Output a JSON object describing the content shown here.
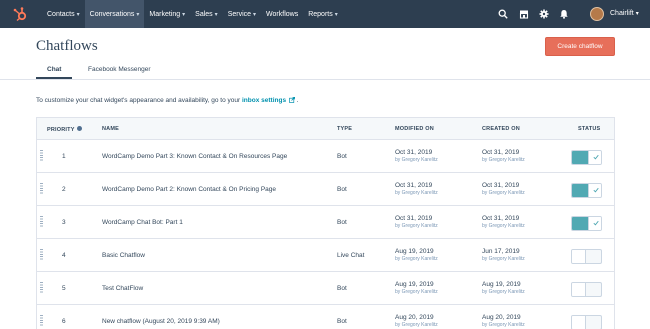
{
  "nav": {
    "items": [
      {
        "label": "Contacts",
        "active": false
      },
      {
        "label": "Conversations",
        "active": true
      },
      {
        "label": "Marketing",
        "active": false
      },
      {
        "label": "Sales",
        "active": false
      },
      {
        "label": "Service",
        "active": false
      },
      {
        "label": "Workflows",
        "active": false,
        "no_caret": true
      },
      {
        "label": "Reports",
        "active": false
      }
    ],
    "icons": [
      "search-icon",
      "marketplace-icon",
      "settings-icon",
      "notifications-icon"
    ],
    "account_name": "Chairlift"
  },
  "page": {
    "title": "Chatflows",
    "create_button": "Create chatflow"
  },
  "tabs": [
    {
      "label": "Chat",
      "active": true
    },
    {
      "label": "Facebook Messenger",
      "active": false
    }
  ],
  "info": {
    "prefix": "To customize your chat widget's appearance and availability, go to your",
    "link": "inbox settings",
    "suffix": "."
  },
  "table": {
    "headers": {
      "priority": "PRIORITY",
      "name": "NAME",
      "type": "TYPE",
      "modified": "MODIFIED ON",
      "created": "CREATED ON",
      "status": "STATUS"
    },
    "rows": [
      {
        "priority": "1",
        "name": "WordCamp Demo Part 3: Known Contact & On Resources Page",
        "type": "Bot",
        "modified": "Oct 31, 2019",
        "modified_by": "by Gregory Karelitz",
        "created": "Oct 31, 2019",
        "created_by": "by Gregory Karelitz",
        "enabled": true
      },
      {
        "priority": "2",
        "name": "WordCamp Demo Part 2: Known Contact & On Pricing Page",
        "type": "Bot",
        "modified": "Oct 31, 2019",
        "modified_by": "by Gregory Karelitz",
        "created": "Oct 31, 2019",
        "created_by": "by Gregory Karelitz",
        "enabled": true
      },
      {
        "priority": "3",
        "name": "WordCamp Chat Bot: Part 1",
        "type": "Bot",
        "modified": "Oct 31, 2019",
        "modified_by": "by Gregory Karelitz",
        "created": "Oct 31, 2019",
        "created_by": "by Gregory Karelitz",
        "enabled": true
      },
      {
        "priority": "4",
        "name": "Basic Chatflow",
        "type": "Live Chat",
        "modified": "Aug 19, 2019",
        "modified_by": "by Gregory Karelitz",
        "created": "Jun 17, 2019",
        "created_by": "by Gregory Karelitz",
        "enabled": false
      },
      {
        "priority": "5",
        "name": "Test ChatFlow",
        "type": "Bot",
        "modified": "Aug 19, 2019",
        "modified_by": "by Gregory Karelitz",
        "created": "Aug 19, 2019",
        "created_by": "by Gregory Karelitz",
        "enabled": false
      },
      {
        "priority": "6",
        "name": "New chatflow (August 20, 2019 9:39 AM)",
        "type": "Bot",
        "modified": "Aug 20, 2019",
        "modified_by": "by Gregory Karelitz",
        "created": "Aug 20, 2019",
        "created_by": "by Gregory Karelitz",
        "enabled": false
      }
    ]
  },
  "colors": {
    "nav_bg": "#2d3e50",
    "accent": "#e76f5a",
    "toggle_on": "#51a9b3",
    "link": "#0091ae"
  }
}
